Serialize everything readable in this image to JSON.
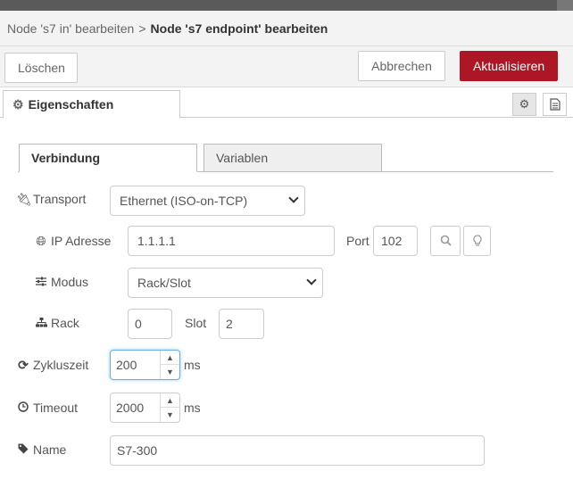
{
  "breadcrumb": {
    "parent": "Node 's7 in' bearbeiten",
    "separator": ">",
    "current": "Node 's7 endpoint' bearbeiten"
  },
  "toolbar": {
    "delete_label": "Löschen",
    "cancel_label": "Abbrechen",
    "update_label": "Aktualisieren",
    "update_color": "#ad1625"
  },
  "tabs": {
    "properties_label": "Eigenschaften"
  },
  "subtabs": {
    "connection_label": "Verbindung",
    "variables_label": "Variablen"
  },
  "form": {
    "transport": {
      "label": "Transport",
      "value": "Ethernet (ISO-on-TCP)",
      "icon": "plug-icon"
    },
    "ip": {
      "label": "IP Adresse",
      "value": "1.1.1.1",
      "icon": "globe-icon"
    },
    "port": {
      "label": "Port",
      "value": "102"
    },
    "mode": {
      "label": "Modus",
      "value": "Rack/Slot",
      "icon": "sliders-icon"
    },
    "rack": {
      "label": "Rack",
      "value": "0",
      "icon": "sitemap-icon"
    },
    "slot": {
      "label": "Slot",
      "value": "2"
    },
    "cycle": {
      "label": "Zykluszeit",
      "value": "200",
      "unit": "ms",
      "icon": "refresh-icon"
    },
    "timeout": {
      "label": "Timeout",
      "value": "2000",
      "unit": "ms",
      "icon": "clock-icon"
    },
    "name": {
      "label": "Name",
      "value": "S7-300",
      "icon": "tag-icon"
    }
  }
}
